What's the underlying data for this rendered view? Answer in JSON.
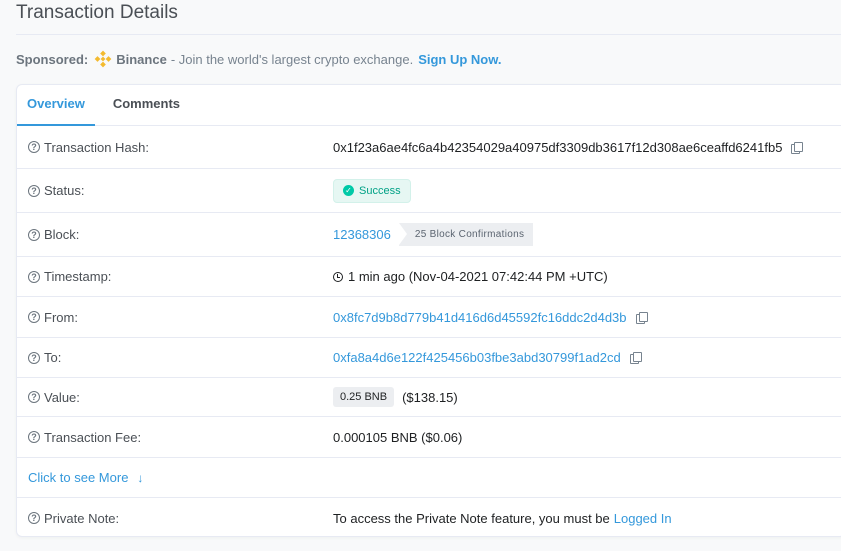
{
  "page": {
    "title": "Transaction Details"
  },
  "sponsor": {
    "label": "Sponsored:",
    "brand": "Binance",
    "text": "- Join the world's largest crypto exchange.",
    "cta": "Sign Up Now."
  },
  "tabs": [
    {
      "label": "Overview",
      "active": true
    },
    {
      "label": "Comments",
      "active": false
    }
  ],
  "details": {
    "hash": {
      "label": "Transaction Hash:",
      "value": "0x1f23a6ae4fc6a4b42354029a40975df3309db3617f12d308ae6ceaffd6241fb5"
    },
    "status": {
      "label": "Status:",
      "value": "Success"
    },
    "block": {
      "label": "Block:",
      "value": "12368306",
      "confirmations": "25 Block Confirmations"
    },
    "timestamp": {
      "label": "Timestamp:",
      "value": "1 min ago (Nov-04-2021 07:42:44 PM +UTC)"
    },
    "from": {
      "label": "From:",
      "value": "0x8fc7d9b8d779b41d416d6d45592fc16ddc2d4d3b"
    },
    "to": {
      "label": "To:",
      "value": "0xfa8a4d6e122f425456b03fbe3abd30799f1ad2cd"
    },
    "value": {
      "label": "Value:",
      "amount": "0.25 BNB",
      "usd": "($138.15)"
    },
    "fee": {
      "label": "Transaction Fee:",
      "value": "0.000105 BNB ($0.06)"
    },
    "see_more": "Click to see More",
    "private_note": {
      "label": "Private Note:",
      "text": "To access the Private Note feature, you must be",
      "link": "Logged In"
    }
  },
  "colors": {
    "accent": "#3498db",
    "success": "#00c9a7",
    "binance": "#f3ba2f"
  }
}
